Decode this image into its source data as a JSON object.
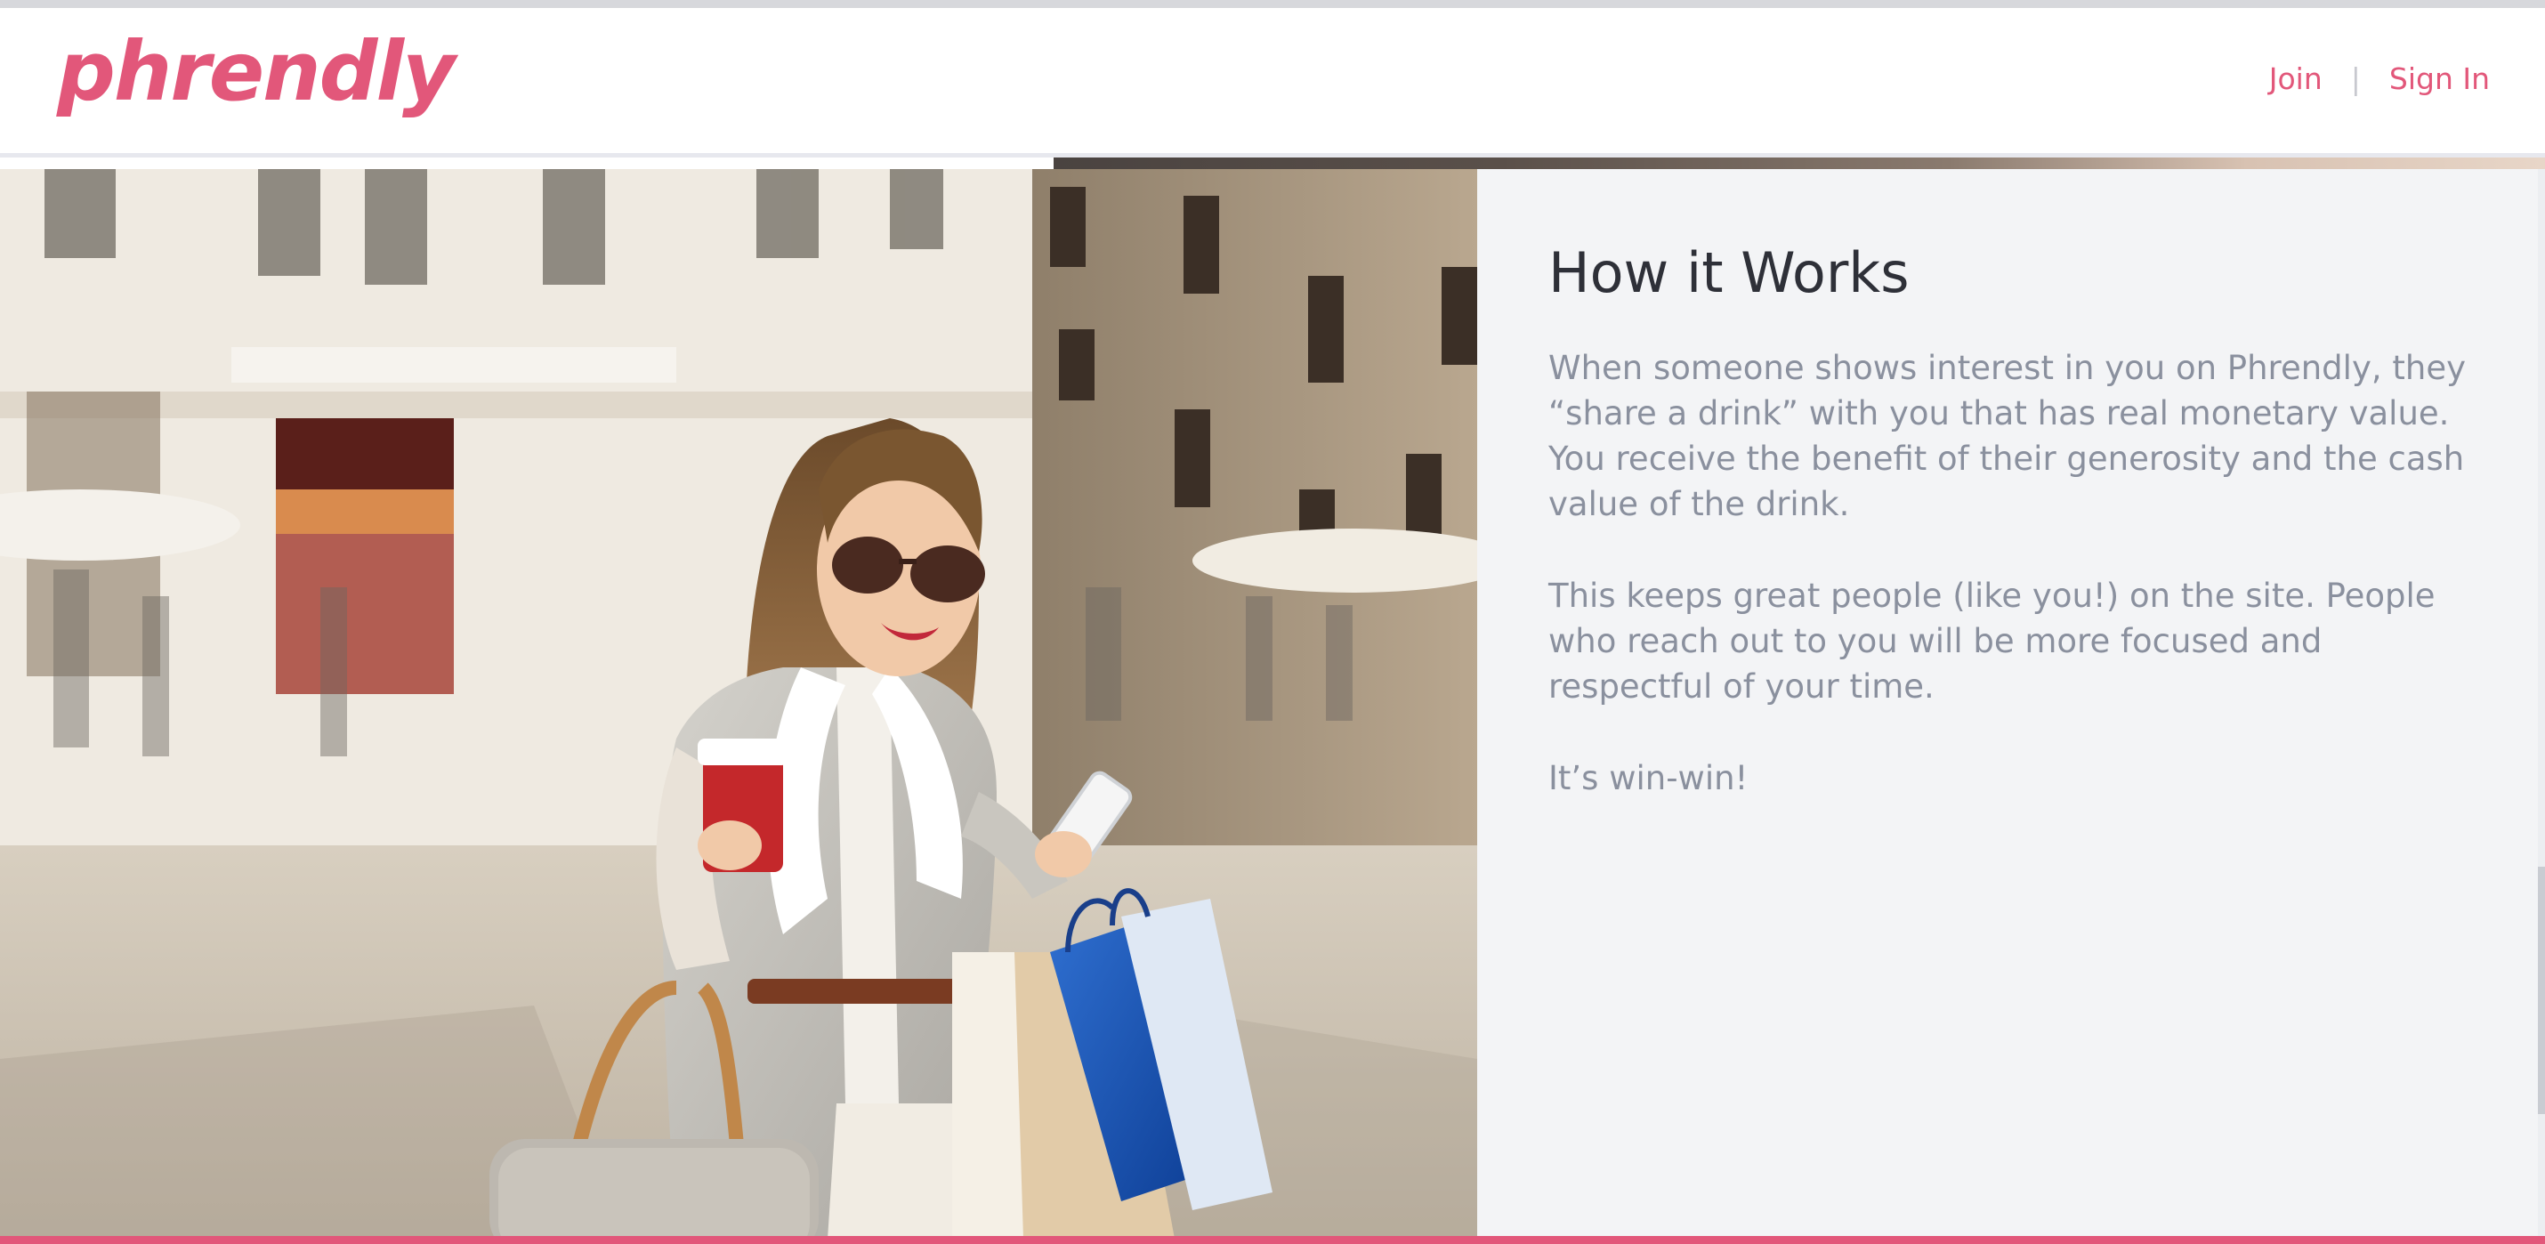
{
  "header": {
    "logo_text": "phrendly",
    "nav": {
      "join_label": "Join",
      "separator": "|",
      "signin_label": "Sign In"
    }
  },
  "hero_image": {
    "description_icon": "photo-woman-shopping-with-phone-and-coffee"
  },
  "how_it_works": {
    "title": "How it Works",
    "paragraphs": [
      "When someone shows interest in you on Phrendly, they “share a drink” with you that has real monetary value. You receive the benefit of their generosity and the cash value of the drink.",
      "This keeps great people (like you!) on the site. People who reach out to you will be more focused and respectful of your time.",
      "It’s win-win!"
    ]
  },
  "colors": {
    "brand": "#e2577a",
    "panel_bg": "#f3f4f6",
    "title": "#2e3038",
    "body_text": "#8a909e"
  }
}
